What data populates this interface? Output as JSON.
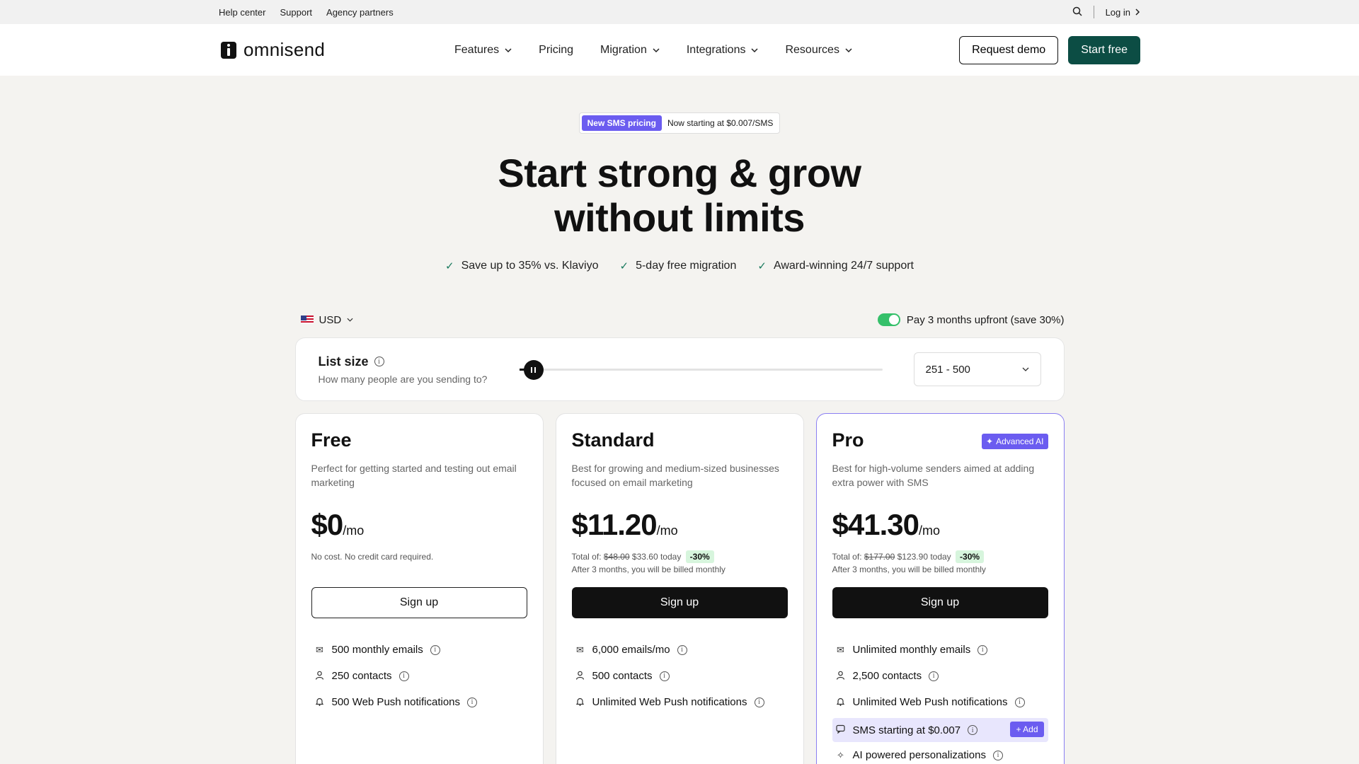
{
  "utility": {
    "links": [
      "Help center",
      "Support",
      "Agency partners"
    ],
    "login": "Log in"
  },
  "nav": {
    "logo": "omnisend",
    "items": [
      "Features",
      "Pricing",
      "Migration",
      "Integrations",
      "Resources"
    ],
    "request_demo": "Request demo",
    "start_free": "Start free"
  },
  "hero": {
    "promo_badge": "New SMS pricing",
    "promo_text": "Now starting at $0.007/SMS",
    "title_line1": "Start strong & grow",
    "title_line2": "without limits",
    "points": [
      "Save up to 35% vs. Klaviyo",
      "5-day free migration",
      "Award-winning 24/7 support"
    ]
  },
  "controls": {
    "currency": "USD",
    "toggle_label": "Pay 3 months upfront (save 30%)",
    "toggle_on": true
  },
  "list_size": {
    "title": "List size",
    "subtitle": "How many people are you sending to?",
    "selected": "251 - 500"
  },
  "plans": [
    {
      "name": "Free",
      "desc": "Perfect for getting started and testing out email marketing",
      "price": "$0",
      "unit": "/mo",
      "note": "No cost. No credit card required.",
      "cta": "Sign up",
      "features": [
        "500 monthly emails",
        "250 contacts",
        "500 Web Push notifications"
      ]
    },
    {
      "name": "Standard",
      "desc": "Best for growing and medium-sized businesses focused on email marketing",
      "price": "$11.20",
      "unit": "/mo",
      "total_label": "Total of:",
      "old_total": "$48.00",
      "new_total": "$33.60 today",
      "discount": "-30%",
      "billing": "After 3 months, you will be billed monthly",
      "cta": "Sign up",
      "features": [
        "6,000 emails/mo",
        "500 contacts",
        "Unlimited Web Push notifications"
      ]
    },
    {
      "name": "Pro",
      "badge": "Advanced AI",
      "desc": "Best for high-volume senders aimed at adding extra power with SMS",
      "price": "$41.30",
      "unit": "/mo",
      "total_label": "Total of:",
      "old_total": "$177.00",
      "new_total": "$123.90 today",
      "discount": "-30%",
      "billing": "After 3 months, you will be billed monthly",
      "cta": "Sign up",
      "features": [
        "Unlimited monthly emails",
        "2,500 contacts",
        "Unlimited Web Push notifications",
        "SMS starting at $0.007",
        "AI powered personalizations"
      ],
      "add_label": "+ Add"
    }
  ],
  "colors": {
    "brand_green": "#0c4d44",
    "accent_purple": "#6b5cf0",
    "toggle_green": "#35c06a"
  }
}
